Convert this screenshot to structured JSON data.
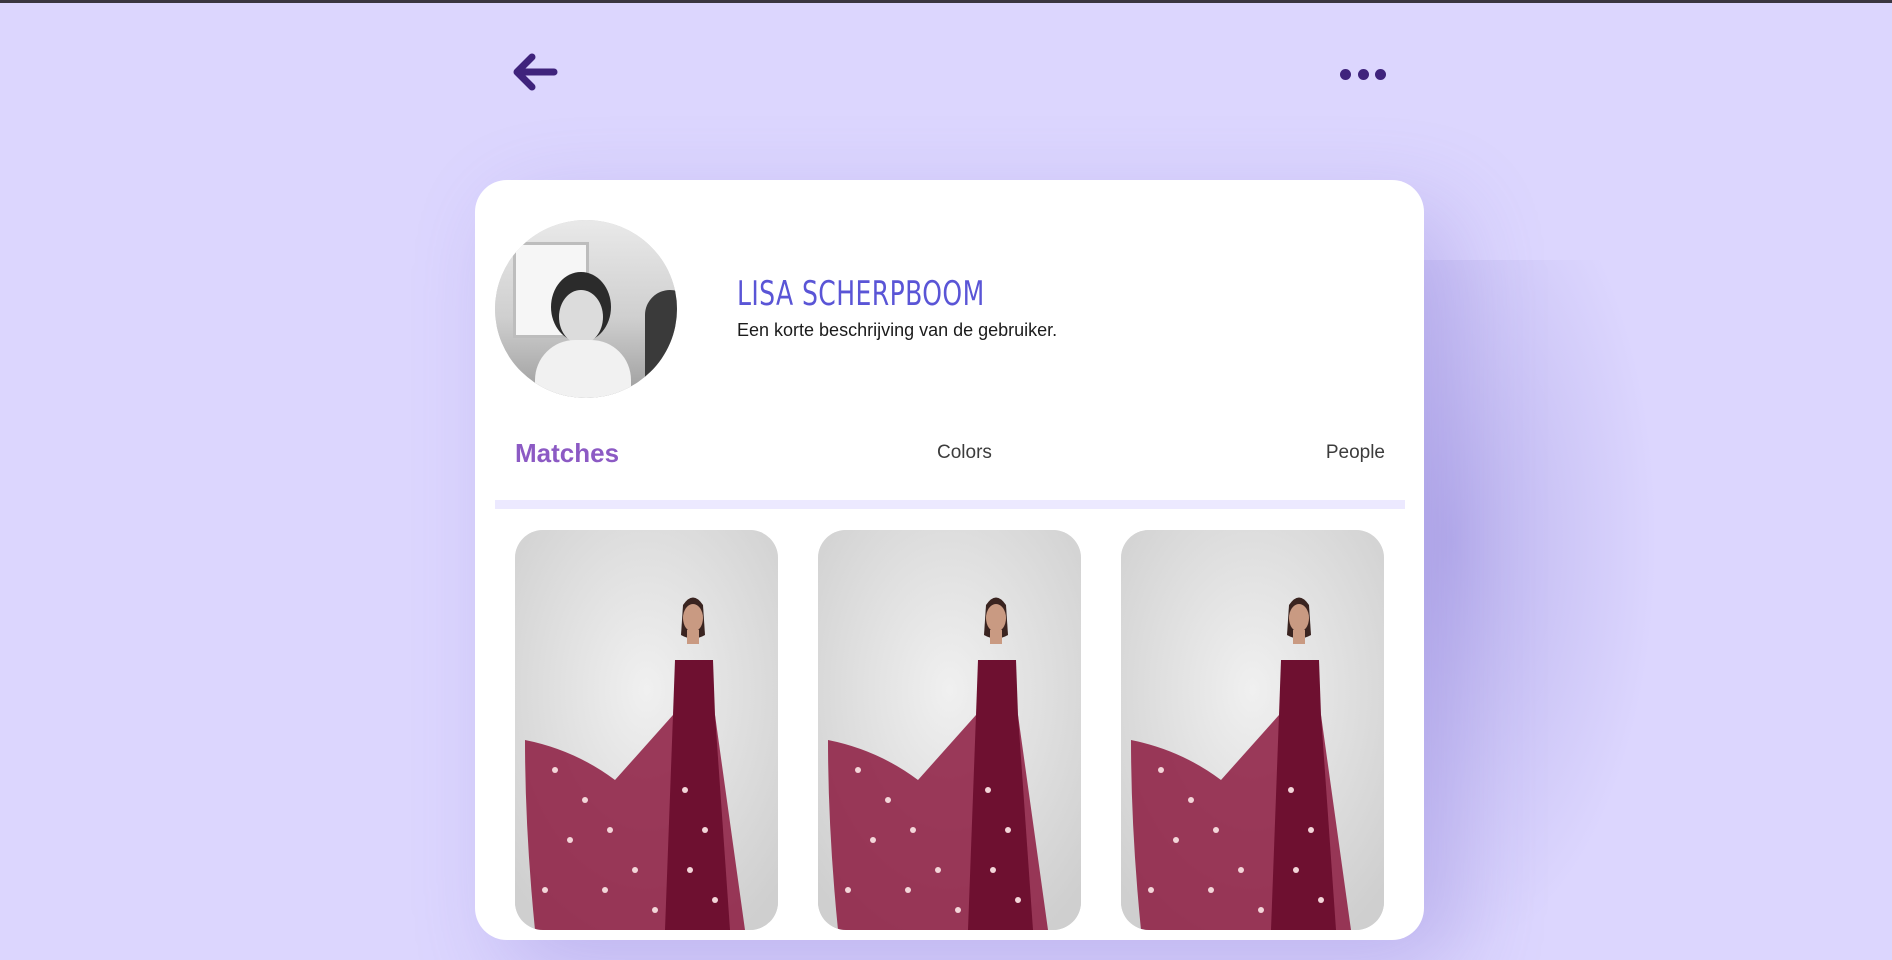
{
  "colors": {
    "background": "#dcd6fe",
    "accent_dark": "#3f237c",
    "name_color": "#5a55d6",
    "active_tab": "#8c5ac4",
    "divider": "#ece9ff"
  },
  "header": {
    "back_icon": "arrow-left-icon",
    "more_icon": "more-horizontal-icon"
  },
  "profile": {
    "name": "LISA SCHERPBOOM",
    "description": "Een korte beschrijving van de gebruiker.",
    "avatar_icon": "profile-photo"
  },
  "tabs": [
    {
      "label": "Matches",
      "active": true
    },
    {
      "label": "Colors",
      "active": false
    },
    {
      "label": "People",
      "active": false
    }
  ],
  "gallery": {
    "items": [
      {
        "icon": "dress-photo"
      },
      {
        "icon": "dress-photo"
      },
      {
        "icon": "dress-photo"
      }
    ]
  }
}
